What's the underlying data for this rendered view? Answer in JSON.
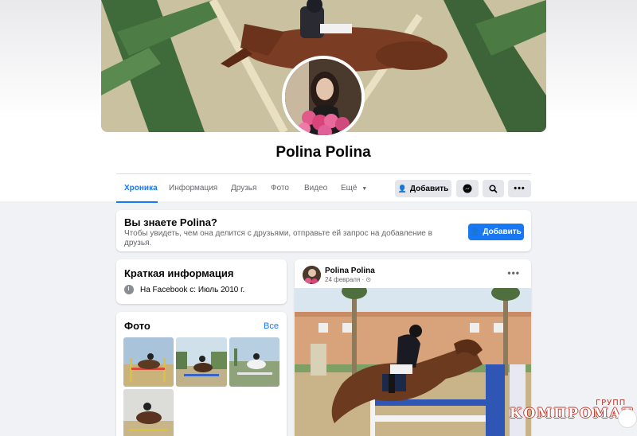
{
  "profile": {
    "name": "Polina Polina"
  },
  "nav": {
    "tabs": [
      "Хроника",
      "Информация",
      "Друзья",
      "Фото",
      "Видео",
      "Ещё"
    ],
    "add_label": "Добавить"
  },
  "know": {
    "title": "Вы знаете Polina?",
    "description": "Чтобы увидеть, чем она делится с друзьями, отправьте ей запрос на добавление в друзья.",
    "add_label": "Добавить"
  },
  "intro": {
    "title": "Краткая информация",
    "joined": "На Facebook с: Июль 2010 г."
  },
  "photos": {
    "title": "Фото",
    "all_link": "Все"
  },
  "post": {
    "author": "Polina Polina",
    "date": "24 февраля · ⊙"
  },
  "watermark": {
    "top": "ГРУПП",
    "main": "КОМПРОМАТ"
  },
  "colors": {
    "accent": "#1877f2",
    "background": "#f0f2f5"
  }
}
